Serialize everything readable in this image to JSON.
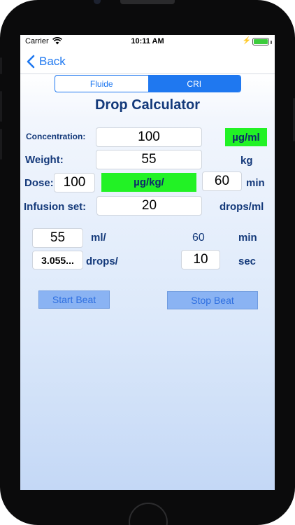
{
  "status_bar": {
    "carrier": "Carrier",
    "time": "10:11 AM",
    "battery_color": "#3ccc3c"
  },
  "nav": {
    "back_label": "Back",
    "accent": "#1f78f0"
  },
  "segments": {
    "items": [
      {
        "label": "Fluide",
        "selected": false
      },
      {
        "label": "CRI",
        "selected": true
      }
    ]
  },
  "title": "Drop Calculator",
  "form": {
    "concentration": {
      "label": "Concentration:",
      "value": "100",
      "unit": "µg/ml"
    },
    "weight": {
      "label": "Weight:",
      "value": "55",
      "unit": "kg"
    },
    "dose": {
      "label": "Dose:",
      "value": "100",
      "unit": "µg/kg/",
      "time_value": "60",
      "time_unit": "min"
    },
    "infusion_set": {
      "label": "Infusion set:",
      "value": "20",
      "unit": "drops/ml"
    }
  },
  "results": {
    "ml_value": "55",
    "ml_unit": "ml/",
    "ml_time": "60",
    "ml_time_unit": "min",
    "drops_value": "3.055...",
    "drops_unit": "drops/",
    "drops_time": "10",
    "drops_time_unit": "sec"
  },
  "buttons": {
    "start": "Start Beat",
    "stop": "Stop Beat"
  },
  "colors": {
    "highlight_green": "#22f225",
    "label_navy": "#14397a",
    "button_blue": "#8ab3f3"
  }
}
